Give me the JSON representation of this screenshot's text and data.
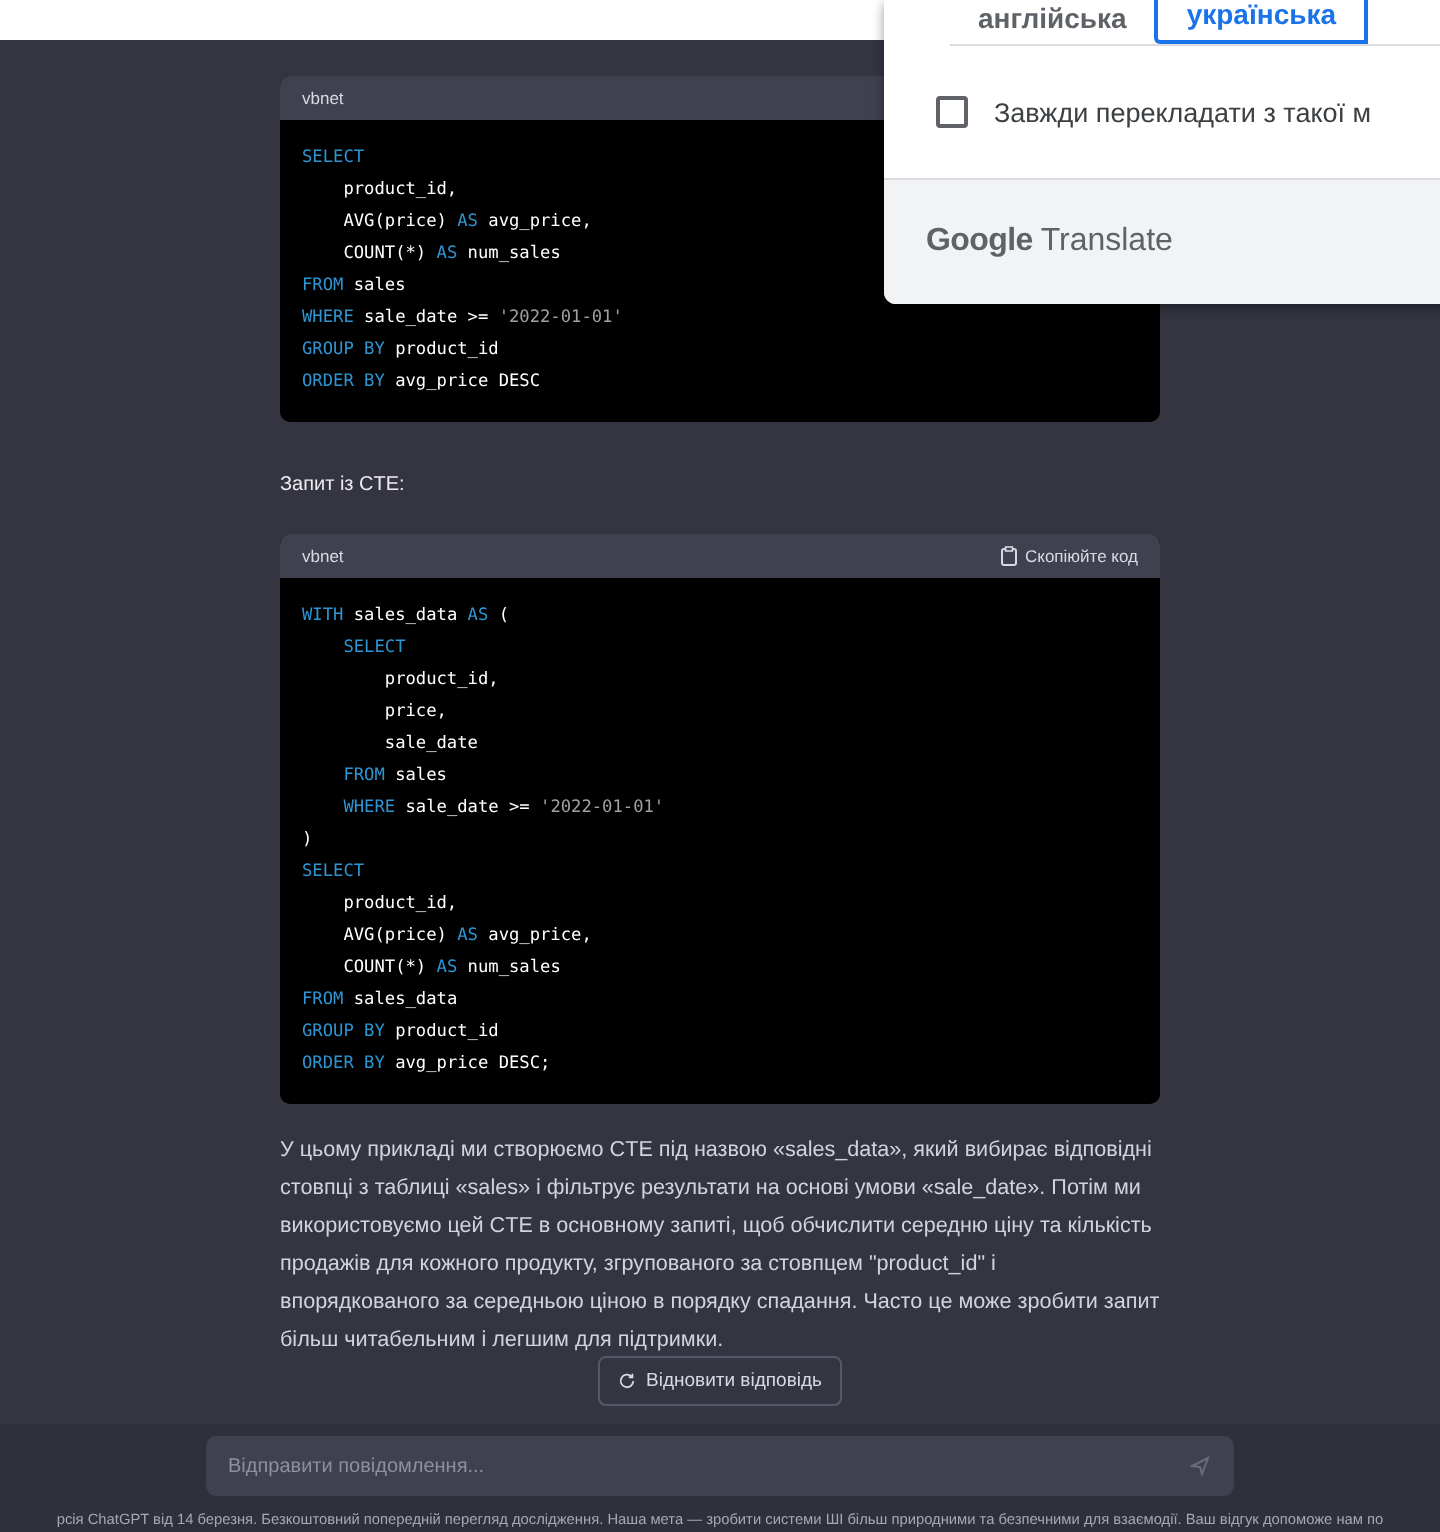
{
  "code_blocks": [
    {
      "language": "vbnet",
      "lines": [
        [
          {
            "kind": "keyword",
            "text": "SELECT"
          }
        ],
        [
          {
            "kind": "plain",
            "text": "    product_id,"
          }
        ],
        [
          {
            "kind": "plain",
            "text": "    AVG(price) "
          },
          {
            "kind": "keyword",
            "text": "AS"
          },
          {
            "kind": "plain",
            "text": " avg_price,"
          }
        ],
        [
          {
            "kind": "plain",
            "text": "    COUNT(*) "
          },
          {
            "kind": "keyword",
            "text": "AS"
          },
          {
            "kind": "plain",
            "text": " num_sales"
          }
        ],
        [
          {
            "kind": "keyword",
            "text": "FROM"
          },
          {
            "kind": "plain",
            "text": " sales"
          }
        ],
        [
          {
            "kind": "keyword",
            "text": "WHERE"
          },
          {
            "kind": "plain",
            "text": " sale_date >= "
          },
          {
            "kind": "string",
            "text": "'2022-01-01'"
          }
        ],
        [
          {
            "kind": "keyword",
            "text": "GROUP BY"
          },
          {
            "kind": "plain",
            "text": " product_id"
          }
        ],
        [
          {
            "kind": "keyword",
            "text": "ORDER BY"
          },
          {
            "kind": "plain",
            "text": " avg_price DESC"
          }
        ]
      ]
    },
    {
      "language": "vbnet",
      "copy_label": "Скопіюйте код",
      "caption": "Запит із CTE:",
      "lines": [
        [
          {
            "kind": "keyword",
            "text": "WITH"
          },
          {
            "kind": "plain",
            "text": " sales_data "
          },
          {
            "kind": "keyword",
            "text": "AS"
          },
          {
            "kind": "plain",
            "text": " ("
          }
        ],
        [
          {
            "kind": "keyword",
            "text": "    SELECT"
          }
        ],
        [
          {
            "kind": "plain",
            "text": "        product_id,"
          }
        ],
        [
          {
            "kind": "plain",
            "text": "        price,"
          }
        ],
        [
          {
            "kind": "plain",
            "text": "        sale_date"
          }
        ],
        [
          {
            "kind": "keyword",
            "text": "    FROM"
          },
          {
            "kind": "plain",
            "text": " sales"
          }
        ],
        [
          {
            "kind": "keyword",
            "text": "    WHERE"
          },
          {
            "kind": "plain",
            "text": " sale_date >= "
          },
          {
            "kind": "string",
            "text": "'2022-01-01'"
          }
        ],
        [
          {
            "kind": "plain",
            "text": ")"
          }
        ],
        [
          {
            "kind": "keyword",
            "text": "SELECT"
          }
        ],
        [
          {
            "kind": "plain",
            "text": "    product_id,"
          }
        ],
        [
          {
            "kind": "plain",
            "text": "    AVG(price) "
          },
          {
            "kind": "keyword",
            "text": "AS"
          },
          {
            "kind": "plain",
            "text": " avg_price,"
          }
        ],
        [
          {
            "kind": "plain",
            "text": "    COUNT(*) "
          },
          {
            "kind": "keyword",
            "text": "AS"
          },
          {
            "kind": "plain",
            "text": " num_sales"
          }
        ],
        [
          {
            "kind": "keyword",
            "text": "FROM"
          },
          {
            "kind": "plain",
            "text": " sales_data"
          }
        ],
        [
          {
            "kind": "keyword",
            "text": "GROUP BY"
          },
          {
            "kind": "plain",
            "text": " product_id"
          }
        ],
        [
          {
            "kind": "keyword",
            "text": "ORDER BY"
          },
          {
            "kind": "plain",
            "text": " avg_price DESC;"
          }
        ]
      ]
    }
  ],
  "explanation": "У цьому прикладі ми створюємо CTE під назвою «sales_data», який вибирає відповідні стовпці з таблиці «sales» і фільтрує результати на основі умови «sale_date». Потім ми використовуємо цей CTE в основному запиті, щоб обчислити середню ціну та кількість продажів для кожного продукту, згрупованого за стовпцем \"product_id\" і впорядкованого за середньою ціною в порядку спадання. Часто це може зробити запит більш читабельним і легшим для підтримки.",
  "regenerate_button": "Відновити відповідь",
  "message_input": {
    "placeholder": "Відправити повідомлення..."
  },
  "footer": "рсія ChatGPT від 14 березня. Безкоштовний попередній перегляд дослідження. Наша мета — зробити системи ШІ більш природними та безпечними для взаємодії. Ваш відгук допоможе нам по",
  "translate_popup": {
    "tabs": [
      {
        "label": "англійська",
        "selected": false
      },
      {
        "label": "українська",
        "selected": true
      }
    ],
    "always_translate": {
      "label": "Завжди перекладати з такої м",
      "checked": false
    },
    "brand": "Google",
    "product": "Translate"
  }
}
